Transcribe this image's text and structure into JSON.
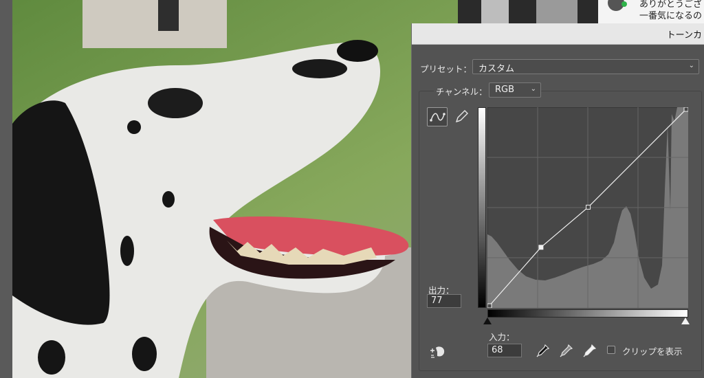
{
  "chat": {
    "line1": "ありがとうござ",
    "line2": "一番気になるの"
  },
  "panel": {
    "title": "トーンカ"
  },
  "preset": {
    "label": "プリセット：",
    "value": "カスタム"
  },
  "channel": {
    "label": "チャンネル：",
    "value": "RGB"
  },
  "output": {
    "label": "出力：",
    "value": "77"
  },
  "input": {
    "label": "入力：",
    "value": "68"
  },
  "clip": {
    "label": "クリップを表示"
  },
  "icons": {
    "curve_tool": "curve-point-icon",
    "pencil_tool": "pencil-icon",
    "target_adjust": "hand-target-icon",
    "black_point": "black-eyedropper-icon",
    "gray_point": "gray-eyedropper-icon",
    "white_point": "white-eyedropper-icon"
  },
  "curve_points": [
    {
      "input": 0,
      "output": 0
    },
    {
      "input": 68,
      "output": 77
    },
    {
      "input": 128,
      "output": 128
    },
    {
      "input": 255,
      "output": 255
    }
  ]
}
